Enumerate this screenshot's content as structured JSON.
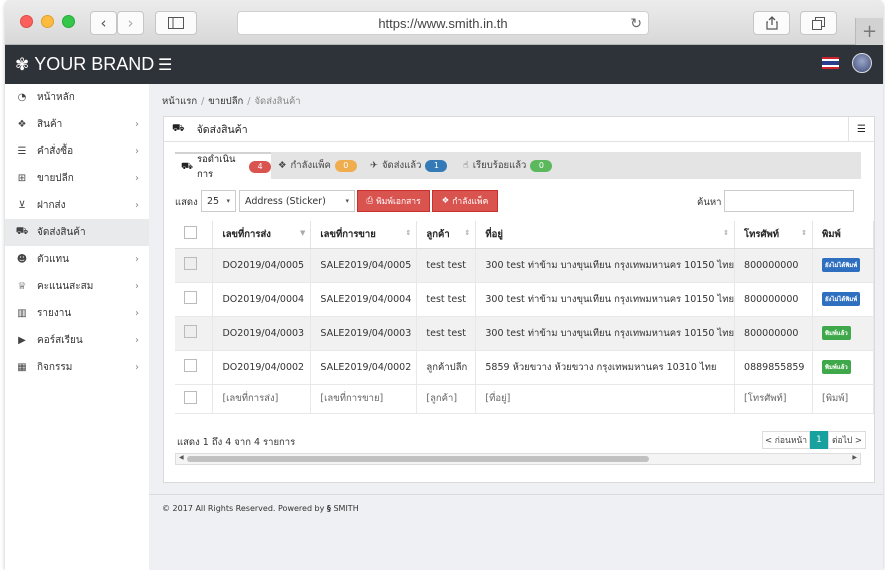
{
  "browser": {
    "url": "https://www.smith.in.th"
  },
  "navbar": {
    "brand": "YOUR BRAND"
  },
  "sidebar": {
    "items": [
      {
        "label": "หน้าหลัก",
        "icon": "dashboard-icon",
        "chevron": false
      },
      {
        "label": "สินค้า",
        "icon": "cubes-icon",
        "chevron": true
      },
      {
        "label": "คำสั่งซื้อ",
        "icon": "list-icon",
        "chevron": true
      },
      {
        "label": "ขายปลีก",
        "icon": "basket-icon",
        "chevron": true
      },
      {
        "label": "ฝากส่ง",
        "icon": "cart-icon",
        "chevron": true
      },
      {
        "label": "จัดส่งสินค้า",
        "icon": "truck-icon",
        "chevron": false
      },
      {
        "label": "ตัวแทน",
        "icon": "users-icon",
        "chevron": true
      },
      {
        "label": "คะแนนสะสม",
        "icon": "trophy-icon",
        "chevron": true
      },
      {
        "label": "รายงาน",
        "icon": "bar-chart-icon",
        "chevron": true
      },
      {
        "label": "คอร์สเรียน",
        "icon": "play-circle-icon",
        "chevron": true
      },
      {
        "label": "กิจกรรม",
        "icon": "calendar-icon",
        "chevron": true
      }
    ]
  },
  "breadcrumb": {
    "home": "หน้าแรก",
    "section": "ขายปลีก",
    "current": "จัดส่งสินค้า"
  },
  "panel": {
    "title": "จัดส่งสินค้า"
  },
  "tabs": [
    {
      "label": "รอดำเนินการ",
      "count": "4",
      "color": "#d9534f"
    },
    {
      "label": "กำลังแพ็ค",
      "count": "0",
      "color": "#f0ad4e"
    },
    {
      "label": "จัดส่งแล้ว",
      "count": "1",
      "color": "#337ab7"
    },
    {
      "label": "เรียบร้อยแล้ว",
      "count": "0",
      "color": "#5cb85c"
    }
  ],
  "controls": {
    "show_label": "แสดง",
    "page_size": "25",
    "doc_type": "Address (Sticker)",
    "print_button": "พิมพ์เอกสาร",
    "pack_button": "กำลังแพ็ค",
    "search_label": "ค้นหา"
  },
  "table": {
    "headers": [
      "เลขที่การส่ง",
      "เลขที่การขาย",
      "ลูกค้า",
      "ที่อยู่",
      "โทรศัพท์",
      "พิมพ์"
    ],
    "rows": [
      {
        "ship_no": "DO2019/04/0005",
        "sale_no": "SALE2019/04/0005",
        "customer": "test test",
        "address": "300 test ท่าข้าม บางขุนเทียน กรุงเทพมหานคร 10150 ไทย",
        "phone": "800000000",
        "print": "ยังไม่ได้พิมพ์",
        "print_color": "#2f6fc0"
      },
      {
        "ship_no": "DO2019/04/0004",
        "sale_no": "SALE2019/04/0004",
        "customer": "test test",
        "address": "300 test ท่าข้าม บางขุนเทียน กรุงเทพมหานคร 10150 ไทย",
        "phone": "800000000",
        "print": "ยังไม่ได้พิมพ์",
        "print_color": "#2f6fc0"
      },
      {
        "ship_no": "DO2019/04/0003",
        "sale_no": "SALE2019/04/0003",
        "customer": "test test",
        "address": "300 test ท่าข้าม บางขุนเทียน กรุงเทพมหานคร 10150 ไทย",
        "phone": "800000000",
        "print": "พิมพ์แล้ว",
        "print_color": "#3fa84a"
      },
      {
        "ship_no": "DO2019/04/0002",
        "sale_no": "SALE2019/04/0002",
        "customer": "ลูกค้าปลีก",
        "address": "5859 ห้วยขวาง ห้วยขวาง กรุงเทพมหานคร 10310 ไทย",
        "phone": "0889855859",
        "print": "พิมพ์แล้ว",
        "print_color": "#3fa84a"
      }
    ],
    "filters": [
      "[เลขที่การส่ง]",
      "[เลขที่การขาย]",
      "[ลูกค้า]",
      "[ที่อยู่]",
      "[โทรศัพท์]",
      "[พิมพ์]"
    ]
  },
  "info": "แสดง 1 ถึง 4 จาก 4 รายการ",
  "pager": {
    "prev": "< ก่อนหน้า",
    "current": "1",
    "next": "ต่อไป >"
  },
  "footer": {
    "text": "© 2017 All Rights Reserved. Powered by",
    "brand": "SMITH"
  }
}
